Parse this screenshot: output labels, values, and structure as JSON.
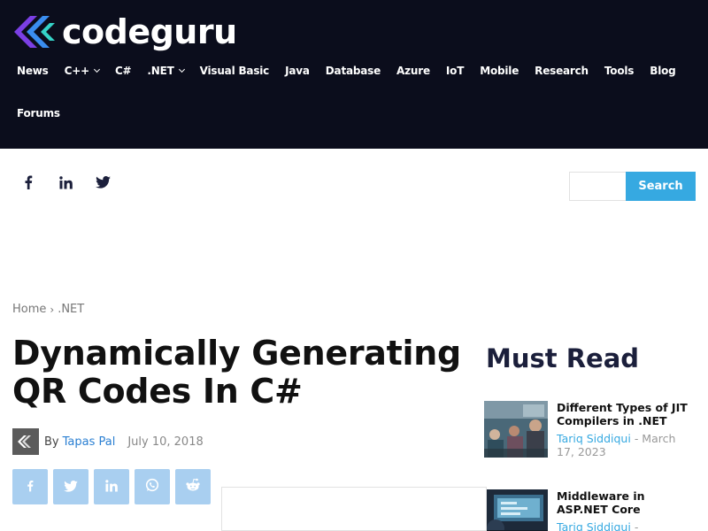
{
  "header": {
    "logo_text": "codeguru",
    "nav_row1": [
      {
        "label": "News",
        "dropdown": false
      },
      {
        "label": "C++",
        "dropdown": true
      },
      {
        "label": "C#",
        "dropdown": false
      },
      {
        "label": ".NET",
        "dropdown": true
      },
      {
        "label": "Visual Basic",
        "dropdown": false
      },
      {
        "label": "Java",
        "dropdown": false
      },
      {
        "label": "Database",
        "dropdown": false
      },
      {
        "label": "Azure",
        "dropdown": false
      },
      {
        "label": "IoT",
        "dropdown": false
      },
      {
        "label": "Mobile",
        "dropdown": false
      },
      {
        "label": "Research",
        "dropdown": false
      },
      {
        "label": "Tools",
        "dropdown": false
      },
      {
        "label": "Blog",
        "dropdown": false
      }
    ],
    "nav_row2": [
      {
        "label": "Forums",
        "dropdown": false
      }
    ]
  },
  "social": [
    "facebook-icon",
    "linkedin-icon",
    "twitter-icon"
  ],
  "search": {
    "placeholder": "",
    "button_label": "Search"
  },
  "breadcrumb": {
    "home": "Home",
    "separator": "›",
    "current": ".NET"
  },
  "article": {
    "title": "Dynamically Generating QR Codes In C#",
    "by_label": "By",
    "author": "Tapas Pal",
    "date": "July 10, 2018"
  },
  "share_buttons": [
    "facebook-icon",
    "twitter-icon",
    "linkedin-icon",
    "whatsapp-icon",
    "reddit-icon"
  ],
  "ad": {
    "close_glyph": "×"
  },
  "must_read": {
    "heading": "Must Read",
    "items": [
      {
        "title": "Different Types of JIT Compilers in .NET",
        "author": "Tariq Siddiqui",
        "date": "March 17, 2023"
      },
      {
        "title": "Middleware in ASP.NET Core",
        "author": "Tariq Siddiqui",
        "date": ""
      }
    ]
  },
  "colors": {
    "header_bg": "#0b0d1c",
    "accent": "#36a9e1",
    "share_bg": "#a9cff0",
    "heading_navy": "#1b1f3b"
  }
}
